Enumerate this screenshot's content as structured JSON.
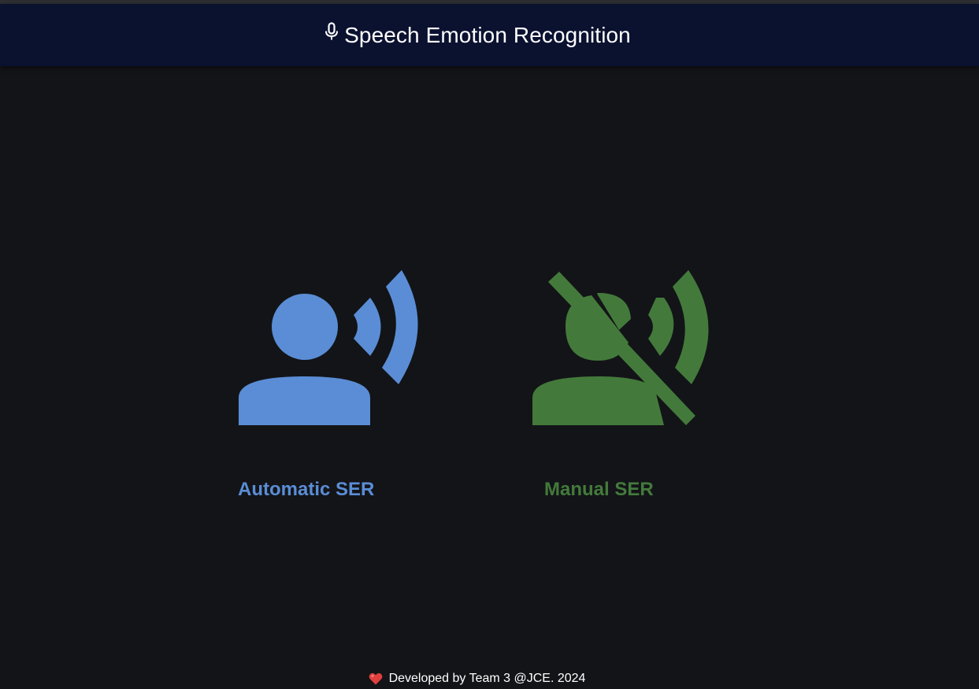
{
  "header": {
    "title": "Speech Emotion Recognition",
    "icon": "mic-icon"
  },
  "cards": {
    "automatic": {
      "label": "Automatic SER",
      "icon": "record-voice-over-icon",
      "color": "#5a8dd5"
    },
    "manual": {
      "label": "Manual SER",
      "icon": "voice-over-off-icon",
      "color": "#437a3b"
    }
  },
  "footer": {
    "icon": "heart-icon",
    "text": "Developed by Team 3 @JCE. 2024"
  },
  "colors": {
    "background": "#131418",
    "header_background": "#0b1230",
    "heart": "#e0403e"
  }
}
